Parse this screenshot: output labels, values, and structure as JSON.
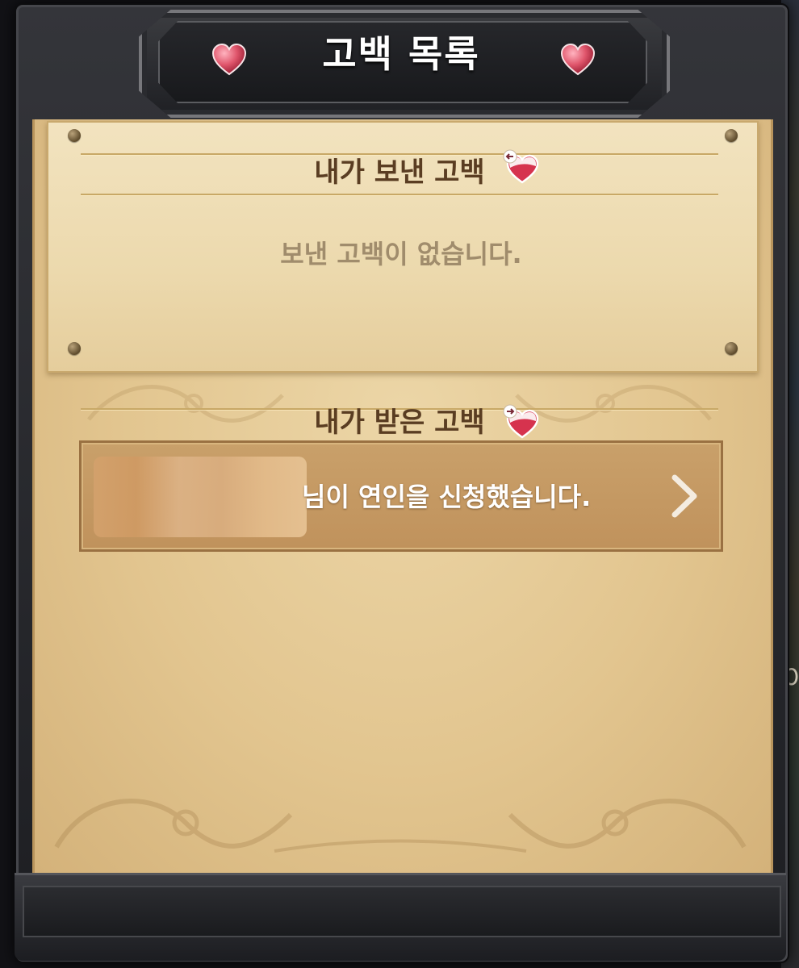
{
  "dialog": {
    "title": "고백 목록",
    "title_icon": "heart-icon"
  },
  "sent_section": {
    "title": "내가 보낸 고백",
    "icon": "heart-sent-arrow-icon",
    "empty_message": "보낸 고백이 없습니다."
  },
  "received_section": {
    "title": "내가 받은 고백",
    "icon": "heart-received-arrow-icon",
    "items": [
      {
        "sender_name_redacted": true,
        "message": "님이 연인을 신청했습니다.",
        "action_icon": "chevron-right-icon"
      }
    ]
  },
  "colors": {
    "frame": "#2a2b30",
    "parchment": "#e6cc97",
    "section_title": "#5a3d22",
    "empty_text": "#a08c6c",
    "row_bg": "#c49862",
    "heart": "#d8405a"
  }
}
